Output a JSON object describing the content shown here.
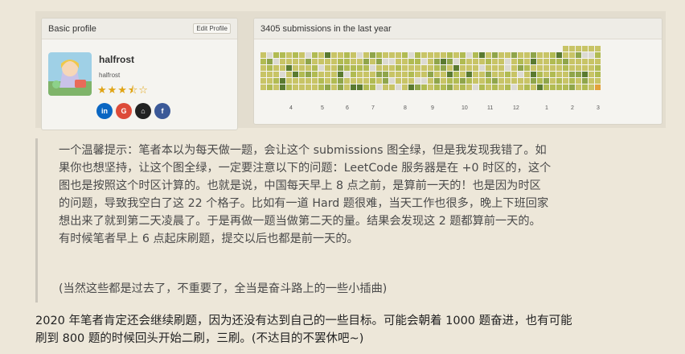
{
  "profile": {
    "title": "Basic profile",
    "edit_label": "Edit Profile",
    "username": "halfrost",
    "realname": "halfrost",
    "rating": 3.5,
    "rating_stars": "★★★⯪☆",
    "socials": [
      {
        "icon": "linkedin-icon",
        "label": "in",
        "color": "#0a66c2"
      },
      {
        "icon": "google-icon",
        "label": "G",
        "color": "#dd4b39"
      },
      {
        "icon": "github-icon",
        "label": "⌂",
        "color": "#222222"
      },
      {
        "icon": "facebook-icon",
        "label": "f",
        "color": "#3b5998"
      }
    ]
  },
  "submissions": {
    "title": "3405 submissions in the last year",
    "months": [
      "4",
      "5",
      "6",
      "7",
      "8",
      "9",
      "10",
      "11",
      "12",
      "1",
      "2",
      "3"
    ],
    "colors": {
      "empty": "#dcdad2",
      "level1": "#c8c466",
      "level2": "#b1bb52",
      "level3": "#8fa54a",
      "level4": "#5a7a30",
      "today": "#e3a13a"
    }
  },
  "notice": {
    "lines": [
      "一个温馨提示：笔者本以为每天做一题，会让这个 submissions 图全绿，但是我发现我错了。如",
      "果你也想坚持，让这个图全绿，一定要注意以下的问题：LeetCode 服务器是在 +0 时区的，这个",
      "图也是按照这个时区计算的。也就是说，中国每天早上 8 点之前，是算前一天的！也是因为时区",
      "的问题，导致我空白了这 22 个格子。比如有一道 Hard 题很难，当天工作也很多，晚上下班回家",
      "想出来了就到第二天凌晨了。于是再做一题当做第二天的量。结果会发现这 2 题都算前一天的。",
      "有时候笔者早上 6 点起床刷题，提交以后也都是前一天的。"
    ],
    "aside": "(当然这些都是过去了，不重要了，全当是奋斗路上的一些小插曲)"
  },
  "followup": {
    "lines": [
      "2020 年笔者肯定还会继续刷题，因为还没有达到自己的一些目标。可能会朝着 1000 题奋进，也有可能",
      "刷到 800 题的时候回头开始二刷，三刷。(不达目的不罢休吧~)"
    ]
  }
}
